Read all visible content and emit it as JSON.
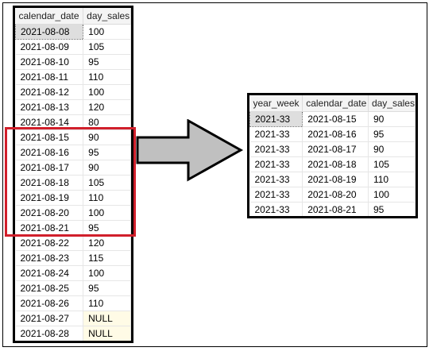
{
  "left_grid": {
    "columns": [
      "calendar_date",
      "day_sales"
    ],
    "rows": [
      [
        "2021-08-08",
        "100"
      ],
      [
        "2021-08-09",
        "105"
      ],
      [
        "2021-08-10",
        "95"
      ],
      [
        "2021-08-11",
        "110"
      ],
      [
        "2021-08-12",
        "100"
      ],
      [
        "2021-08-13",
        "120"
      ],
      [
        "2021-08-14",
        "80"
      ],
      [
        "2021-08-15",
        "90"
      ],
      [
        "2021-08-16",
        "95"
      ],
      [
        "2021-08-17",
        "90"
      ],
      [
        "2021-08-18",
        "105"
      ],
      [
        "2021-08-19",
        "110"
      ],
      [
        "2021-08-20",
        "100"
      ],
      [
        "2021-08-21",
        "95"
      ],
      [
        "2021-08-22",
        "120"
      ],
      [
        "2021-08-23",
        "115"
      ],
      [
        "2021-08-24",
        "100"
      ],
      [
        "2021-08-25",
        "95"
      ],
      [
        "2021-08-26",
        "110"
      ],
      [
        "2021-08-27",
        "NULL"
      ],
      [
        "2021-08-28",
        "NULL"
      ]
    ]
  },
  "right_grid": {
    "columns": [
      "year_week",
      "calendar_date",
      "day_sales"
    ],
    "rows": [
      [
        "2021-33",
        "2021-08-15",
        "90"
      ],
      [
        "2021-33",
        "2021-08-16",
        "95"
      ],
      [
        "2021-33",
        "2021-08-17",
        "90"
      ],
      [
        "2021-33",
        "2021-08-18",
        "105"
      ],
      [
        "2021-33",
        "2021-08-19",
        "110"
      ],
      [
        "2021-33",
        "2021-08-20",
        "100"
      ],
      [
        "2021-33",
        "2021-08-21",
        "95"
      ]
    ]
  },
  "colors": {
    "highlight": "#d11f2b",
    "arrow_fill": "#c0c0c0",
    "null_cell": "#fffbe6"
  }
}
